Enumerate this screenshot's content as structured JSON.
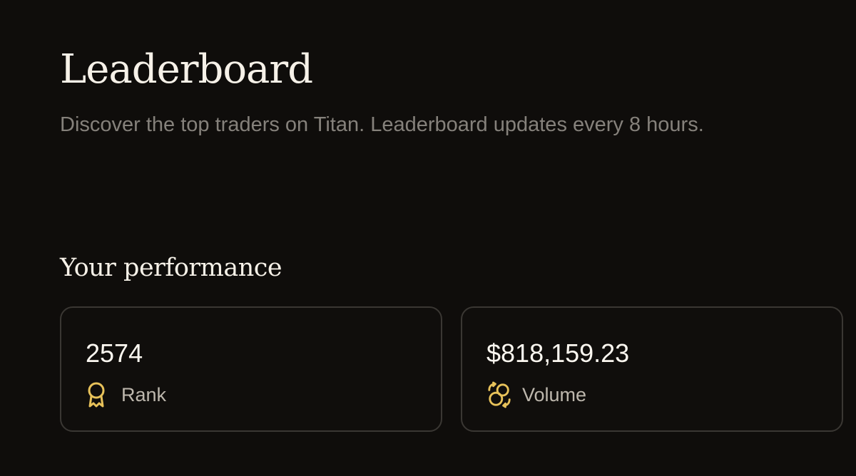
{
  "header": {
    "title": "Leaderboard",
    "subtitle": "Discover the top traders on Titan. Leaderboard updates every 8 hours."
  },
  "performance": {
    "section_title": "Your performance",
    "stats": [
      {
        "value": "2574",
        "label": "Rank",
        "icon": "award-ribbon-icon"
      },
      {
        "value": "$818,159.23",
        "label": "Volume",
        "icon": "coins-exchange-icon"
      }
    ]
  },
  "colors": {
    "background": "#0f0d0b",
    "card_border": "#3a3733",
    "accent_gold": "#e8c25a",
    "muted_text": "#85817b"
  }
}
